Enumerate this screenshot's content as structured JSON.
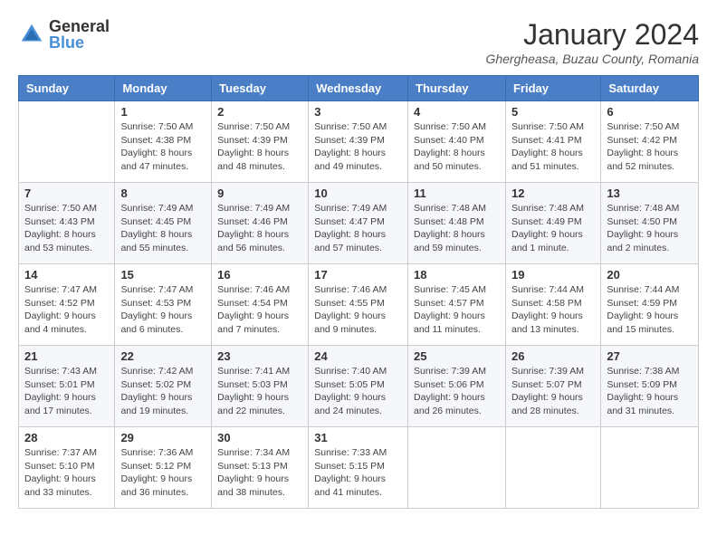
{
  "logo": {
    "general": "General",
    "blue": "Blue"
  },
  "header": {
    "month": "January 2024",
    "location": "Ghergheasa, Buzau County, Romania"
  },
  "weekdays": [
    "Sunday",
    "Monday",
    "Tuesday",
    "Wednesday",
    "Thursday",
    "Friday",
    "Saturday"
  ],
  "weeks": [
    [
      {
        "day": "",
        "sunrise": "",
        "sunset": "",
        "daylight": ""
      },
      {
        "day": "1",
        "sunrise": "Sunrise: 7:50 AM",
        "sunset": "Sunset: 4:38 PM",
        "daylight": "Daylight: 8 hours and 47 minutes."
      },
      {
        "day": "2",
        "sunrise": "Sunrise: 7:50 AM",
        "sunset": "Sunset: 4:39 PM",
        "daylight": "Daylight: 8 hours and 48 minutes."
      },
      {
        "day": "3",
        "sunrise": "Sunrise: 7:50 AM",
        "sunset": "Sunset: 4:39 PM",
        "daylight": "Daylight: 8 hours and 49 minutes."
      },
      {
        "day": "4",
        "sunrise": "Sunrise: 7:50 AM",
        "sunset": "Sunset: 4:40 PM",
        "daylight": "Daylight: 8 hours and 50 minutes."
      },
      {
        "day": "5",
        "sunrise": "Sunrise: 7:50 AM",
        "sunset": "Sunset: 4:41 PM",
        "daylight": "Daylight: 8 hours and 51 minutes."
      },
      {
        "day": "6",
        "sunrise": "Sunrise: 7:50 AM",
        "sunset": "Sunset: 4:42 PM",
        "daylight": "Daylight: 8 hours and 52 minutes."
      }
    ],
    [
      {
        "day": "7",
        "sunrise": "Sunrise: 7:50 AM",
        "sunset": "Sunset: 4:43 PM",
        "daylight": "Daylight: 8 hours and 53 minutes."
      },
      {
        "day": "8",
        "sunrise": "Sunrise: 7:49 AM",
        "sunset": "Sunset: 4:45 PM",
        "daylight": "Daylight: 8 hours and 55 minutes."
      },
      {
        "day": "9",
        "sunrise": "Sunrise: 7:49 AM",
        "sunset": "Sunset: 4:46 PM",
        "daylight": "Daylight: 8 hours and 56 minutes."
      },
      {
        "day": "10",
        "sunrise": "Sunrise: 7:49 AM",
        "sunset": "Sunset: 4:47 PM",
        "daylight": "Daylight: 8 hours and 57 minutes."
      },
      {
        "day": "11",
        "sunrise": "Sunrise: 7:48 AM",
        "sunset": "Sunset: 4:48 PM",
        "daylight": "Daylight: 8 hours and 59 minutes."
      },
      {
        "day": "12",
        "sunrise": "Sunrise: 7:48 AM",
        "sunset": "Sunset: 4:49 PM",
        "daylight": "Daylight: 9 hours and 1 minute."
      },
      {
        "day": "13",
        "sunrise": "Sunrise: 7:48 AM",
        "sunset": "Sunset: 4:50 PM",
        "daylight": "Daylight: 9 hours and 2 minutes."
      }
    ],
    [
      {
        "day": "14",
        "sunrise": "Sunrise: 7:47 AM",
        "sunset": "Sunset: 4:52 PM",
        "daylight": "Daylight: 9 hours and 4 minutes."
      },
      {
        "day": "15",
        "sunrise": "Sunrise: 7:47 AM",
        "sunset": "Sunset: 4:53 PM",
        "daylight": "Daylight: 9 hours and 6 minutes."
      },
      {
        "day": "16",
        "sunrise": "Sunrise: 7:46 AM",
        "sunset": "Sunset: 4:54 PM",
        "daylight": "Daylight: 9 hours and 7 minutes."
      },
      {
        "day": "17",
        "sunrise": "Sunrise: 7:46 AM",
        "sunset": "Sunset: 4:55 PM",
        "daylight": "Daylight: 9 hours and 9 minutes."
      },
      {
        "day": "18",
        "sunrise": "Sunrise: 7:45 AM",
        "sunset": "Sunset: 4:57 PM",
        "daylight": "Daylight: 9 hours and 11 minutes."
      },
      {
        "day": "19",
        "sunrise": "Sunrise: 7:44 AM",
        "sunset": "Sunset: 4:58 PM",
        "daylight": "Daylight: 9 hours and 13 minutes."
      },
      {
        "day": "20",
        "sunrise": "Sunrise: 7:44 AM",
        "sunset": "Sunset: 4:59 PM",
        "daylight": "Daylight: 9 hours and 15 minutes."
      }
    ],
    [
      {
        "day": "21",
        "sunrise": "Sunrise: 7:43 AM",
        "sunset": "Sunset: 5:01 PM",
        "daylight": "Daylight: 9 hours and 17 minutes."
      },
      {
        "day": "22",
        "sunrise": "Sunrise: 7:42 AM",
        "sunset": "Sunset: 5:02 PM",
        "daylight": "Daylight: 9 hours and 19 minutes."
      },
      {
        "day": "23",
        "sunrise": "Sunrise: 7:41 AM",
        "sunset": "Sunset: 5:03 PM",
        "daylight": "Daylight: 9 hours and 22 minutes."
      },
      {
        "day": "24",
        "sunrise": "Sunrise: 7:40 AM",
        "sunset": "Sunset: 5:05 PM",
        "daylight": "Daylight: 9 hours and 24 minutes."
      },
      {
        "day": "25",
        "sunrise": "Sunrise: 7:39 AM",
        "sunset": "Sunset: 5:06 PM",
        "daylight": "Daylight: 9 hours and 26 minutes."
      },
      {
        "day": "26",
        "sunrise": "Sunrise: 7:39 AM",
        "sunset": "Sunset: 5:07 PM",
        "daylight": "Daylight: 9 hours and 28 minutes."
      },
      {
        "day": "27",
        "sunrise": "Sunrise: 7:38 AM",
        "sunset": "Sunset: 5:09 PM",
        "daylight": "Daylight: 9 hours and 31 minutes."
      }
    ],
    [
      {
        "day": "28",
        "sunrise": "Sunrise: 7:37 AM",
        "sunset": "Sunset: 5:10 PM",
        "daylight": "Daylight: 9 hours and 33 minutes."
      },
      {
        "day": "29",
        "sunrise": "Sunrise: 7:36 AM",
        "sunset": "Sunset: 5:12 PM",
        "daylight": "Daylight: 9 hours and 36 minutes."
      },
      {
        "day": "30",
        "sunrise": "Sunrise: 7:34 AM",
        "sunset": "Sunset: 5:13 PM",
        "daylight": "Daylight: 9 hours and 38 minutes."
      },
      {
        "day": "31",
        "sunrise": "Sunrise: 7:33 AM",
        "sunset": "Sunset: 5:15 PM",
        "daylight": "Daylight: 9 hours and 41 minutes."
      },
      {
        "day": "",
        "sunrise": "",
        "sunset": "",
        "daylight": ""
      },
      {
        "day": "",
        "sunrise": "",
        "sunset": "",
        "daylight": ""
      },
      {
        "day": "",
        "sunrise": "",
        "sunset": "",
        "daylight": ""
      }
    ]
  ]
}
